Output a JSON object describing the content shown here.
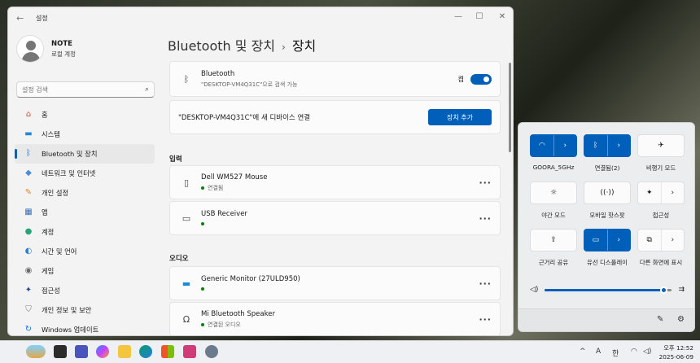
{
  "window": {
    "app_title": "설정",
    "minimize": "—",
    "maximize": "☐",
    "close": "✕"
  },
  "profile": {
    "name": "NOTE",
    "account": "로컬 계정"
  },
  "search": {
    "placeholder": "설정 검색"
  },
  "nav": [
    {
      "label": "홈",
      "icon": "home-icon"
    },
    {
      "label": "시스템",
      "icon": "system-icon"
    },
    {
      "label": "Bluetooth 및 장치",
      "icon": "bluetooth-icon",
      "active": true
    },
    {
      "label": "네트워크 및 인터넷",
      "icon": "network-icon"
    },
    {
      "label": "개인 설정",
      "icon": "personalization-icon"
    },
    {
      "label": "앱",
      "icon": "apps-icon"
    },
    {
      "label": "계정",
      "icon": "accounts-icon"
    },
    {
      "label": "시간 및 언어",
      "icon": "time-language-icon"
    },
    {
      "label": "게임",
      "icon": "gaming-icon"
    },
    {
      "label": "접근성",
      "icon": "accessibility-icon"
    },
    {
      "label": "개인 정보 및 보안",
      "icon": "privacy-shield-icon"
    },
    {
      "label": "Windows 업데이트",
      "icon": "windows-update-icon"
    }
  ],
  "breadcrumb": {
    "parent": "Bluetooth 및 장치",
    "separator": "›",
    "current": "장치"
  },
  "bluetooth_card": {
    "title": "Bluetooth",
    "subtitle": "\"DESKTOP-VM4Q31C\"으로 검색 가능",
    "state_label": "켬",
    "enabled": true
  },
  "add_card": {
    "text": "\"DESKTOP-VM4Q31C\"에 새 디바이스 연결",
    "button": "장치 추가"
  },
  "sections": {
    "input": {
      "heading": "입력",
      "devices": [
        {
          "name": "Dell WM527 Mouse",
          "status": "연결됨",
          "icon": "mouse-icon"
        },
        {
          "name": "USB Receiver",
          "status": "",
          "icon": "keyboard-icon"
        }
      ]
    },
    "audio": {
      "heading": "오디오",
      "devices": [
        {
          "name": "Generic Monitor (27ULD950)",
          "status": "",
          "icon": "monitor-icon"
        },
        {
          "name": "Mi Bluetooth Speaker",
          "status": "연결된 오디오",
          "icon": "headphones-icon"
        }
      ]
    }
  },
  "more_glyph": "···",
  "quick_settings": {
    "tiles": [
      {
        "label": "GOORA_5GHz",
        "icon": "wifi-icon",
        "on": true,
        "expand": true
      },
      {
        "label": "연결됨(2)",
        "icon": "bluetooth-icon",
        "on": true,
        "expand": true
      },
      {
        "label": "비행기 모드",
        "icon": "airplane-icon",
        "on": false,
        "expand": false
      },
      {
        "label": "야간 모드",
        "icon": "brightness-icon",
        "on": false,
        "expand": false
      },
      {
        "label": "모바일 핫스팟",
        "icon": "hotspot-icon",
        "on": false,
        "expand": false
      },
      {
        "label": "접근성",
        "icon": "accessibility-icon",
        "on": false,
        "expand": true
      },
      {
        "label": "근거리 공유",
        "icon": "nearby-share-icon",
        "on": false,
        "expand": false
      },
      {
        "label": "유선 디스플레이",
        "icon": "cast-icon",
        "on": true,
        "expand": true
      },
      {
        "label": "다른 화면에 표시",
        "icon": "project-icon",
        "on": false,
        "expand": true
      }
    ],
    "volume_level": 0.93
  },
  "taskbar": {
    "tray": {
      "expand": "^",
      "ime_a": "A",
      "ime_han": "한"
    },
    "clock": {
      "time": "오후 12:52",
      "date": "2025-06-09"
    }
  },
  "colors": {
    "accent": "#005fb8",
    "connected_dot": "#0f7b0f"
  }
}
